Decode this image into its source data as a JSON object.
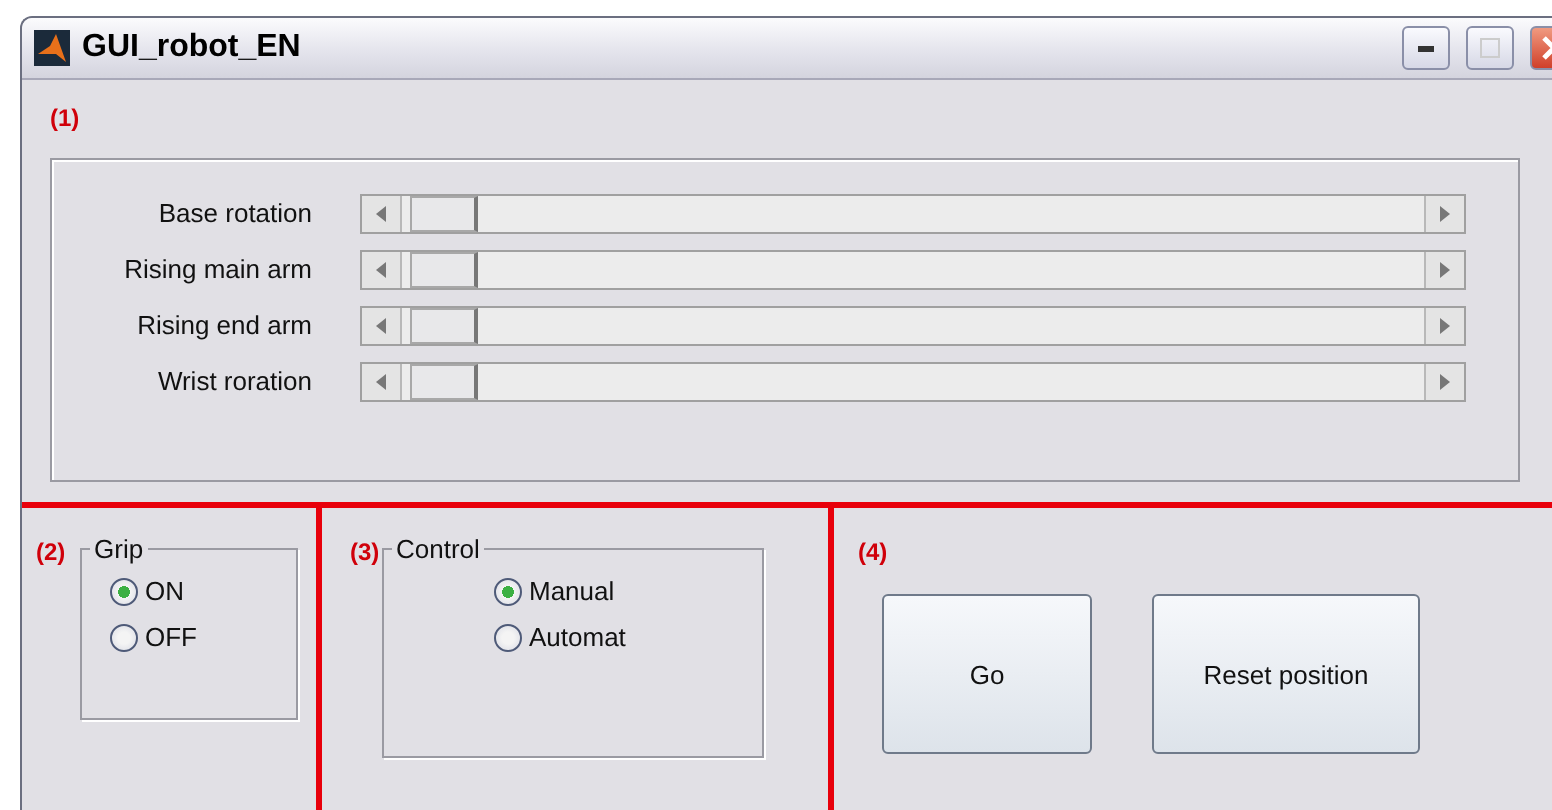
{
  "window": {
    "title": "GUI_robot_EN"
  },
  "section_1": {
    "tag": "(1)",
    "sliders": [
      {
        "label": "Base rotation",
        "level": 0
      },
      {
        "label": "Rising main arm",
        "level": 0
      },
      {
        "label": "Rising end arm",
        "level": 0
      },
      {
        "label": "Wrist roration",
        "level": 0
      }
    ]
  },
  "section_2": {
    "tag": "(2)",
    "group": "Grip",
    "options": [
      {
        "label": "ON",
        "selected": true
      },
      {
        "label": "OFF",
        "selected": false
      }
    ]
  },
  "section_3": {
    "tag": "(3)",
    "group": "Control",
    "options": [
      {
        "label": "Manual",
        "selected": true
      },
      {
        "label": "Automat",
        "selected": false
      }
    ]
  },
  "section_4": {
    "tag": "(4)",
    "buttons": [
      "Go",
      "Reset position"
    ]
  }
}
